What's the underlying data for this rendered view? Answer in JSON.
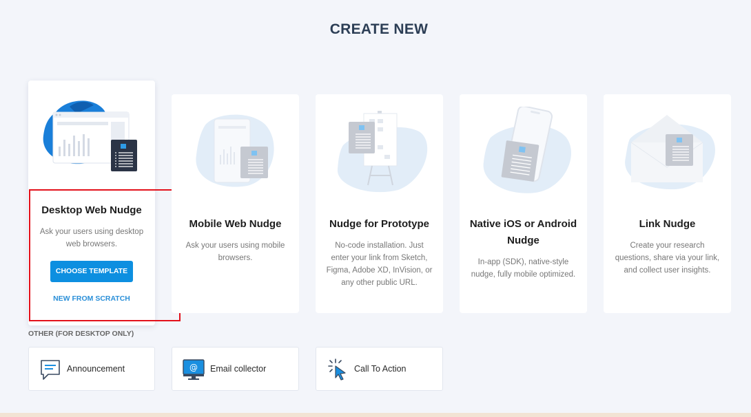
{
  "page": {
    "title": "CREATE NEW"
  },
  "cards": [
    {
      "title": "Desktop Web Nudge",
      "desc": "Ask your users using desktop web browsers.",
      "primary_button": "CHOOSE TEMPLATE",
      "secondary_link": "NEW FROM SCRATCH",
      "icon": "desktop-illustration"
    },
    {
      "title": "Mobile Web Nudge",
      "desc": "Ask your users using mobile browsers.",
      "icon": "mobile-web-illustration"
    },
    {
      "title": "Nudge for Prototype",
      "desc": "No-code installation. Just enter your link from Sketch, Figma, Adobe XD, InVision, or any other public URL.",
      "icon": "prototype-easel-illustration"
    },
    {
      "title": "Native iOS or Android Nudge",
      "desc": "In-app (SDK), native-style nudge, fully mobile optimized.",
      "icon": "phone-illustration"
    },
    {
      "title": "Link Nudge",
      "desc": "Create your research questions, share via your link, and collect user insights.",
      "icon": "envelope-illustration"
    }
  ],
  "other": {
    "label": "OTHER (FOR DESKTOP ONLY)",
    "items": [
      {
        "label": "Announcement",
        "icon": "chat-bubble-icon"
      },
      {
        "label": "Email collector",
        "icon": "email-monitor-icon"
      },
      {
        "label": "Call To Action",
        "icon": "cursor-click-icon"
      }
    ]
  },
  "colors": {
    "accent": "#0d8fe0",
    "link": "#2a8fd8",
    "title": "#2c3e55",
    "highlight": "#e3101a"
  }
}
